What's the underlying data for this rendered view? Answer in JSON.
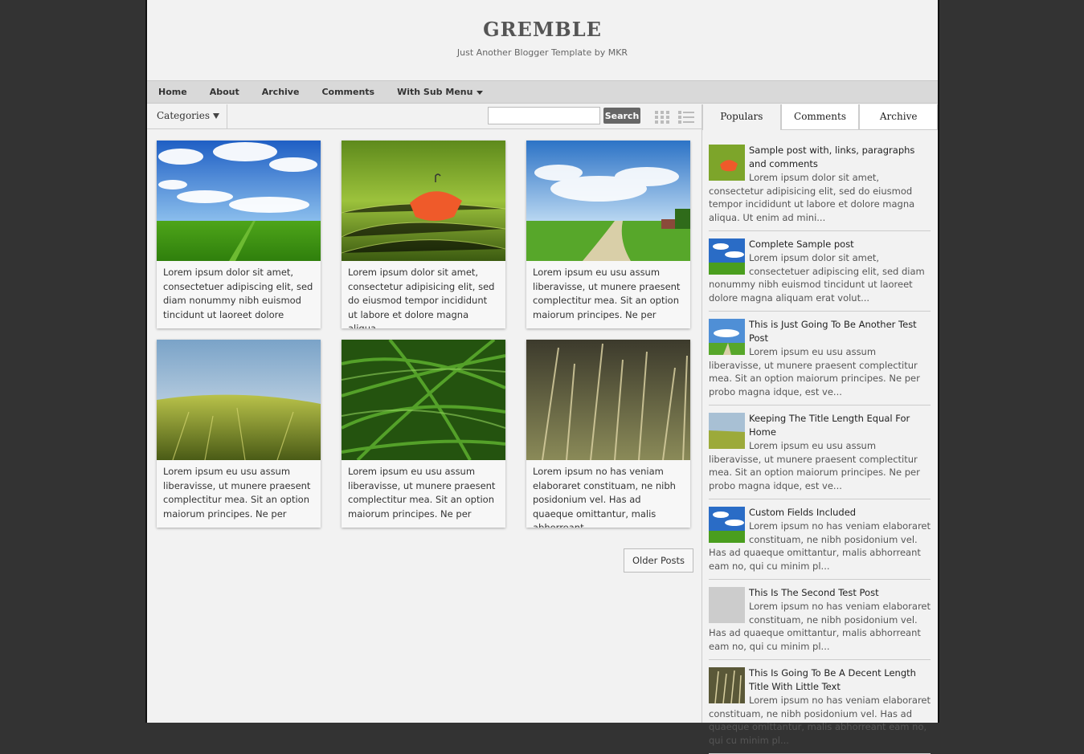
{
  "header": {
    "title": "GREMBLE",
    "description": "Just Another Blogger Template by MKR"
  },
  "nav": {
    "items": [
      "Home",
      "About",
      "Archive",
      "Comments",
      "With Sub Menu"
    ]
  },
  "toolbar": {
    "categories_label": "Categories",
    "search_placeholder": "",
    "search_button": "Search"
  },
  "posts": [
    {
      "thumb": "sky-field",
      "snippet": "Lorem ipsum dolor sit amet, consectetuer adipiscing elit, sed diam nonummy nibh euismod tincidunt ut laoreet dolore"
    },
    {
      "thumb": "umbrella-grass",
      "snippet": "Lorem ipsum dolor sit amet, consectetur adipisicing elit, sed do eiusmod tempor incididunt ut labore et dolore magna aliqua."
    },
    {
      "thumb": "path-landscape",
      "snippet": "Lorem ipsum eu usu assum liberavisse, ut munere praesent complectitur mea. Sit an option maiorum principes. Ne per"
    },
    {
      "thumb": "wheat-field",
      "snippet": "Lorem ipsum eu usu assum liberavisse, ut munere praesent complectitur mea. Sit an option maiorum principes. Ne per"
    },
    {
      "thumb": "green-grass",
      "snippet": "Lorem ipsum eu usu assum liberavisse, ut munere praesent complectitur mea. Sit an option maiorum principes. Ne per"
    },
    {
      "thumb": "dry-grass",
      "snippet": "Lorem ipsum no has veniam elaboraret constituam, ne nibh posidonium vel. Has ad quaeque omittantur, malis abhorreant"
    }
  ],
  "pagination": {
    "older_label": "Older Posts"
  },
  "sidebar": {
    "tabs": [
      "Populars",
      "Comments",
      "Archive"
    ],
    "popular": [
      {
        "title": "Sample post with, links, paragraphs and comments",
        "snippet": "Lorem ipsum dolor sit amet, consectetur adipisicing elit, sed do eiusmod tempor incididunt ut labore et dolore magna aliqua. Ut enim ad mini..."
      },
      {
        "title": "Complete Sample post",
        "snippet": "Lorem ipsum dolor sit amet, consectetuer adipiscing elit, sed diam nonummy nibh euismod tincidunt ut laoreet dolore magna aliquam erat volut..."
      },
      {
        "title": "This is Just Going To Be Another Test Post",
        "snippet": "Lorem ipsum eu usu assum liberavisse, ut munere praesent complectitur mea. Sit an option maiorum principes. Ne per probo magna idque, est ve..."
      },
      {
        "title": "Keeping The Title Length Equal For Home",
        "snippet": "Lorem ipsum eu usu assum liberavisse, ut munere praesent complectitur mea. Sit an option maiorum principes. Ne per probo magna idque, est ve..."
      },
      {
        "title": "Custom Fields Included",
        "snippet": "Lorem ipsum no has veniam elaboraret constituam, ne nibh posidonium vel. Has ad quaeque omittantur, malis abhorreant eam no, qui cu minim pl..."
      },
      {
        "title": "This Is The Second Test Post",
        "snippet": "Lorem ipsum no has veniam elaboraret constituam, ne nibh posidonium vel. Has ad quaeque omittantur, malis abhorreant eam no, qui cu minim pl..."
      },
      {
        "title": "This Is Going To Be A Decent Length Title With Little Text",
        "snippet": "Lorem ipsum no has veniam elaboraret constituam, ne nibh posidonium vel. Has ad quaeque omittantur, malis abhorreant eam no, qui cu minim pl..."
      }
    ]
  },
  "colors": {
    "page_bg": "#f2f2f2",
    "outer_bg": "#333333",
    "nav_bg": "#d9d9d9",
    "search_button": "#666666"
  }
}
